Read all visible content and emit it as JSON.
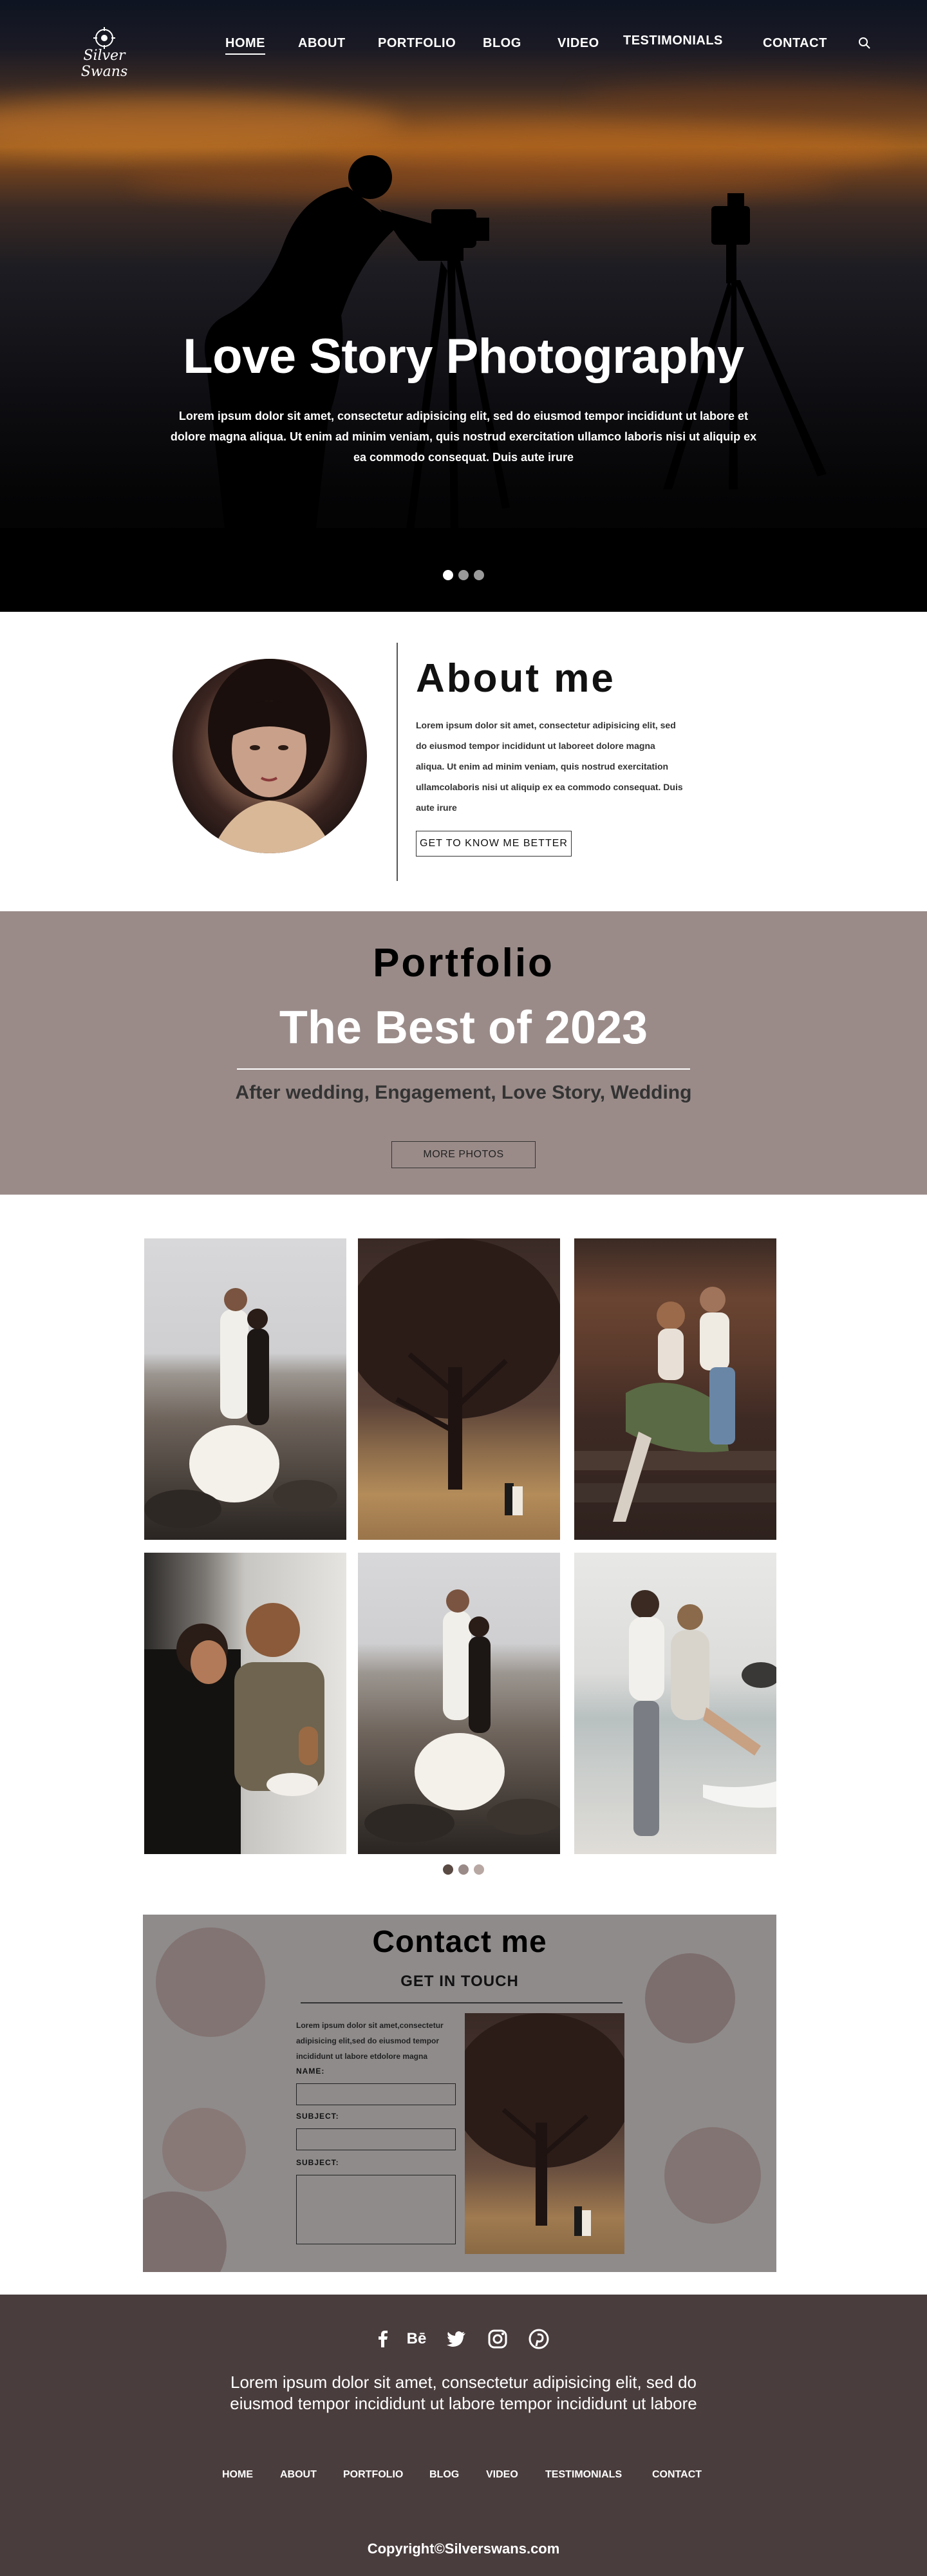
{
  "nav": {
    "logo_text": "Silver Swans",
    "links": [
      "HOME",
      "ABOUT",
      "PORTFOLIO",
      "BLOG",
      "VIDEO",
      "TESTIMONIALS",
      "CONTACT"
    ],
    "active": "HOME"
  },
  "hero": {
    "title": "Love Story Photography",
    "subtitle": "Lorem ipsum dolor sit amet, consectetur adipisicing elit, sed do eiusmod tempor incididunt ut labore et dolore magna aliqua. Ut enim ad minim veniam, quis nostrud exercitation ullamco laboris nisi ut aliquip ex ea commodo consequat. Duis aute irure"
  },
  "about": {
    "title": "About me",
    "text": "Lorem ipsum dolor sit amet, consectetur adipisicing elit, sed do eiusmod tempor incididunt ut laboreet dolore magna aliqua. Ut enim ad minim veniam, quis nostrud exercitation ullamcolaboris nisi ut aliquip ex ea commodo consequat. Duis aute irure",
    "button": "GET TO KNOW ME BETTER"
  },
  "portfolio": {
    "title": "Portfolio",
    "headline": "The Best of 2023",
    "categories": "After wedding, Engagement, Love Story, Wedding",
    "button": "MORE PHOTOS"
  },
  "contact": {
    "title": "Contact me",
    "subtitle": "GET IN TOUCH",
    "intro": "Lorem ipsum dolor sit amet,consectetur adipisicing elit,sed do eiusmod tempor incididunt ut labore etdolore magna",
    "name_label": "NAME:",
    "subject_label_1": "SUBJECT:",
    "subject_label_2": "SUBJECT:"
  },
  "footer": {
    "social_icons": [
      "facebook-icon",
      "behance-icon",
      "twitter-icon",
      "instagram-icon",
      "pinterest-icon"
    ],
    "behance_text": "Bē",
    "text": "Lorem ipsum dolor sit amet, consectetur adipisicing elit, sed do eiusmod tempor incididunt ut labore tempor incididunt ut labore",
    "links": [
      "HOME",
      "ABOUT",
      "PORTFOLIO",
      "BLOG",
      "VIDEO",
      "TESTIMONIALS",
      "CONTACT"
    ],
    "copyright": "Copyright©Silverswans.com"
  },
  "colors": {
    "portfolio_band": "#9a8b89",
    "footer_bg": "#4a3d3d",
    "contact_bg": "#8f8b8b"
  }
}
